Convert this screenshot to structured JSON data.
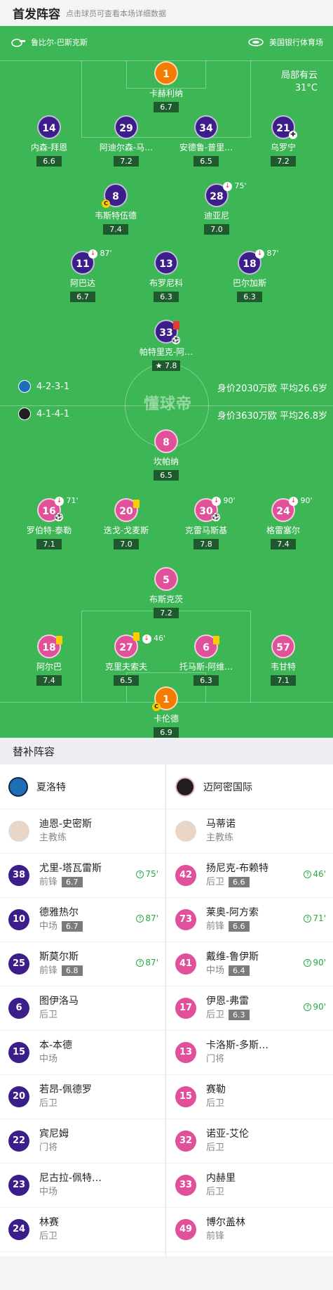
{
  "header": {
    "title": "首发阵容",
    "subtitle": "点击球员可查看本场详细数据"
  },
  "match_info": {
    "referee": "鲁比尔-巴斯克斯",
    "venue": "美国银行体育场",
    "weather": "局部有云",
    "temperature": "31°C"
  },
  "watermark": "懂球帝",
  "home_team": {
    "name": "夏洛特",
    "formation": "4-2-3-1",
    "value": "身价2030万欧 平均26.6岁",
    "color": "#3b1e8a"
  },
  "away_team": {
    "name": "迈阿密国际",
    "formation": "4-1-4-1",
    "value": "身价3630万欧 平均26.8岁",
    "color": "#e0519a"
  },
  "home_lineup": [
    {
      "num": "1",
      "name": "卡赫利纳",
      "rating": "6.7"
    },
    {
      "num": "14",
      "name": "内森-拜恩",
      "rating": "6.6"
    },
    {
      "num": "29",
      "name": "阿迪尔森-马…",
      "rating": "7.2"
    },
    {
      "num": "34",
      "name": "安德鲁-普里…",
      "rating": "6.5"
    },
    {
      "num": "21",
      "name": "乌罗宁",
      "rating": "7.2"
    },
    {
      "num": "8",
      "name": "韦斯特伍德",
      "rating": "7.4",
      "captain": "C"
    },
    {
      "num": "28",
      "name": "迪亚尼",
      "rating": "7.0",
      "sub_out": "75'"
    },
    {
      "num": "11",
      "name": "阿巴达",
      "rating": "6.7",
      "sub_out": "87'"
    },
    {
      "num": "13",
      "name": "布罗尼科",
      "rating": "6.3"
    },
    {
      "num": "18",
      "name": "巴尔加斯",
      "rating": "6.3",
      "sub_out": "87'"
    },
    {
      "num": "33",
      "name": "帕特里克-阿…",
      "rating": "7.8"
    }
  ],
  "away_lineup": [
    {
      "num": "8",
      "name": "坎帕纳",
      "rating": "6.5"
    },
    {
      "num": "16",
      "name": "罗伯特-泰勒",
      "rating": "7.1",
      "sub_out": "71'"
    },
    {
      "num": "20",
      "name": "迭戈-戈麦斯",
      "rating": "7.0"
    },
    {
      "num": "30",
      "name": "克雷马斯基",
      "rating": "7.8",
      "sub_out": "90'"
    },
    {
      "num": "24",
      "name": "格雷塞尔",
      "rating": "7.4",
      "sub_out": "90'"
    },
    {
      "num": "5",
      "name": "布斯克茨",
      "rating": "7.2"
    },
    {
      "num": "18",
      "name": "阿尔巴",
      "rating": "7.4"
    },
    {
      "num": "27",
      "name": "克里夫索夫",
      "rating": "6.5",
      "sub_out": "46'"
    },
    {
      "num": "6",
      "name": "托马斯-阿维…",
      "rating": "6.3"
    },
    {
      "num": "57",
      "name": "韦甘特",
      "rating": "7.1"
    },
    {
      "num": "1",
      "name": "卡伦德",
      "rating": "6.9",
      "captain": "C"
    }
  ],
  "subs": {
    "title": "替补阵容",
    "home_coach": {
      "name": "迪恩-史密斯",
      "role": "主教练"
    },
    "away_coach": {
      "name": "马蒂诺",
      "role": "主教练"
    },
    "home": [
      {
        "num": "38",
        "name": "尤里-塔瓦雷斯",
        "pos": "前锋",
        "rating": "6.7",
        "in": "75'"
      },
      {
        "num": "10",
        "name": "德雅热尔",
        "pos": "中场",
        "rating": "6.7",
        "in": "87'"
      },
      {
        "num": "25",
        "name": "斯莫尔斯",
        "pos": "前锋",
        "rating": "6.8",
        "in": "87'"
      },
      {
        "num": "6",
        "name": "图伊洛马",
        "pos": "后卫"
      },
      {
        "num": "15",
        "name": "本-本德",
        "pos": "中场"
      },
      {
        "num": "20",
        "name": "若昂-佩德罗",
        "pos": "后卫"
      },
      {
        "num": "22",
        "name": "宾尼姆",
        "pos": "门将"
      },
      {
        "num": "23",
        "name": "尼古拉-佩特…",
        "pos": "中场"
      },
      {
        "num": "24",
        "name": "林赛",
        "pos": "后卫"
      }
    ],
    "away": [
      {
        "num": "42",
        "name": "扬尼克-布赖特",
        "pos": "后卫",
        "rating": "6.6",
        "in": "46'"
      },
      {
        "num": "73",
        "name": "莱奥-阿方索",
        "pos": "前锋",
        "rating": "6.6",
        "in": "71'"
      },
      {
        "num": "41",
        "name": "戴维-鲁伊斯",
        "pos": "中场",
        "rating": "6.4",
        "in": "90'"
      },
      {
        "num": "17",
        "name": "伊恩-弗雷",
        "pos": "后卫",
        "rating": "6.3",
        "in": "90'"
      },
      {
        "num": "13",
        "name": "卡洛斯-多斯…",
        "pos": "门将"
      },
      {
        "num": "15",
        "name": "赛勒",
        "pos": "后卫"
      },
      {
        "num": "32",
        "name": "诺亚-艾伦",
        "pos": "后卫"
      },
      {
        "num": "33",
        "name": "内赫里",
        "pos": "后卫"
      },
      {
        "num": "49",
        "name": "博尔盖林",
        "pos": "前锋"
      }
    ]
  }
}
